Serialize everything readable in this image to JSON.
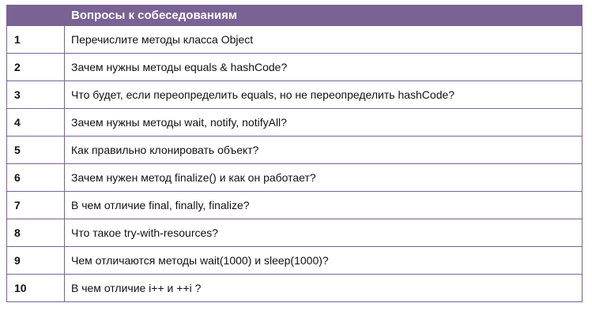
{
  "table": {
    "header_number": "",
    "header_title": "Вопросы к собеседованиям",
    "rows": [
      {
        "number": "1",
        "question": "Перечислите методы класса Object"
      },
      {
        "number": "2",
        "question": "Зачем нужны методы equals & hashCode?"
      },
      {
        "number": "3",
        "question": "Что будет, если переопределить equals, но не переопределить hashCode?"
      },
      {
        "number": "4",
        "question": "Зачем нужны методы wait, notify, notifyAll?"
      },
      {
        "number": "5",
        "question": "Как правильно клонировать объект?"
      },
      {
        "number": "6",
        "question": "Зачем нужен метод finalize() и как он работает?"
      },
      {
        "number": "7",
        "question": "В чем отличие final, finally, finalize?"
      },
      {
        "number": "8",
        "question": "Что такое try-with-resources?"
      },
      {
        "number": "9",
        "question": "Чем отличаются методы wait(1000) и sleep(1000)?"
      },
      {
        "number": "10",
        "question": "В чем отличие i++ и ++i ?"
      }
    ]
  },
  "colors": {
    "header_background": "#7a6294",
    "border": "#7a6294",
    "header_text": "#ffffff",
    "body_text": "#111111"
  }
}
